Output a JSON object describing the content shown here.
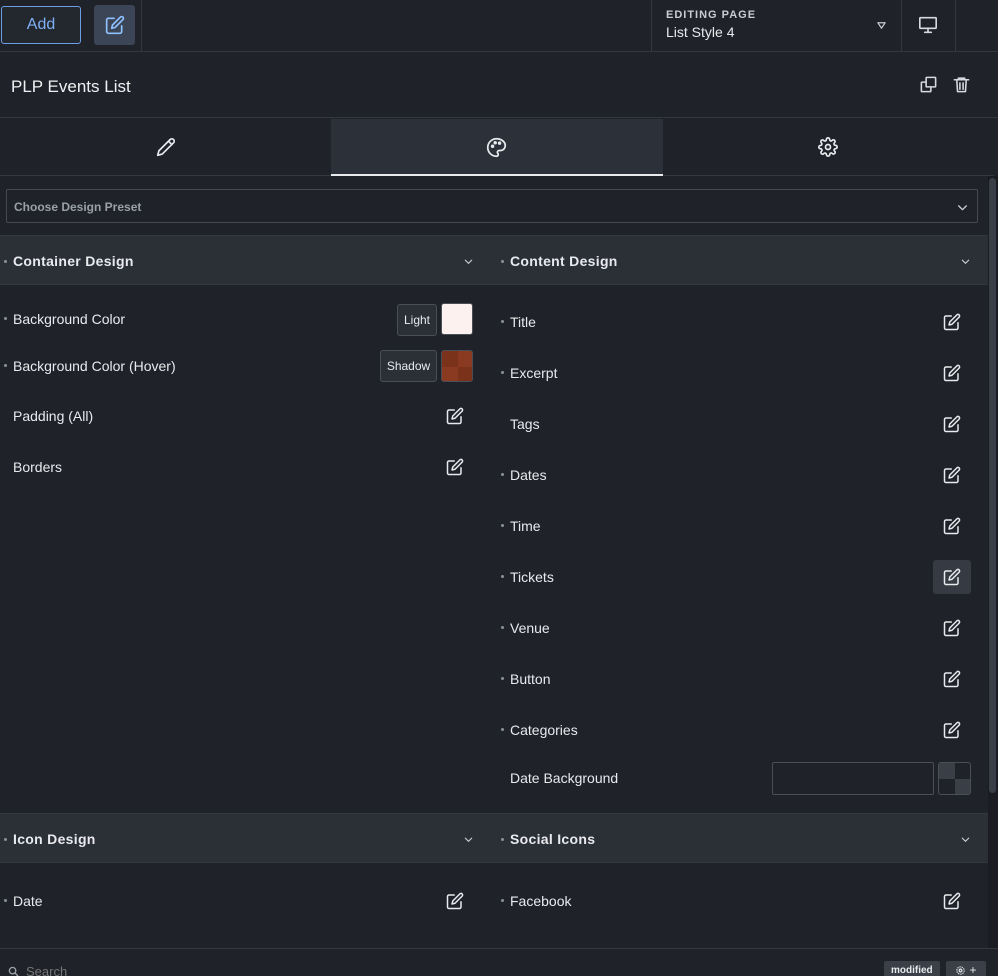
{
  "topbar": {
    "add_label": "Add",
    "editing_label": "EDITING PAGE",
    "editing_value": "List Style 4"
  },
  "header": {
    "title": "PLP Events List"
  },
  "tabs": [
    {
      "name": "content",
      "icon": "pencil-icon"
    },
    {
      "name": "design",
      "icon": "palette-icon",
      "active": true
    },
    {
      "name": "settings",
      "icon": "gear-icon"
    }
  ],
  "preset": {
    "placeholder": "Choose Design Preset"
  },
  "container_design": {
    "title": "Container Design",
    "rows": {
      "bg": {
        "label": "Background Color",
        "chip": "Light",
        "swatch_color": "#fdf1ef"
      },
      "bg_hover": {
        "label": "Background Color (Hover)",
        "chip": "Shadow",
        "swatch_color": "#8a3a20"
      },
      "padding": {
        "label": "Padding (All)"
      },
      "borders": {
        "label": "Borders"
      }
    }
  },
  "content_design": {
    "title": "Content Design",
    "rows": [
      "Title",
      "Excerpt",
      "Tags",
      "Dates",
      "Time",
      "Tickets",
      "Venue",
      "Button",
      "Categories"
    ],
    "date_background": {
      "label": "Date Background",
      "value": ""
    }
  },
  "icon_design": {
    "title": "Icon Design",
    "rows": [
      "Date"
    ]
  },
  "social_icons": {
    "title": "Social Icons",
    "rows": [
      "Facebook"
    ]
  },
  "bottombar": {
    "search_placeholder": "Search",
    "modified_label": "modified",
    "plus_label": "+"
  },
  "colors": {
    "accent": "#7fb0f5",
    "background": "#1f2228",
    "section_bg": "#2b2f36"
  }
}
